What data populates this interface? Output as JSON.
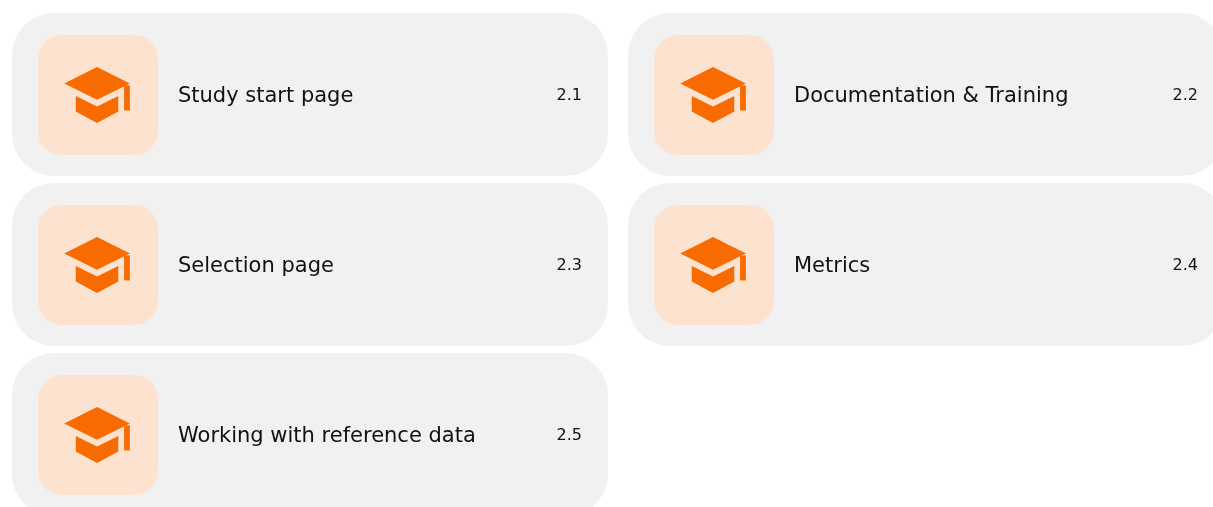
{
  "lessons": [
    {
      "title": "Study start page",
      "number": "2.1"
    },
    {
      "title": "Documentation & Training",
      "number": "2.2"
    },
    {
      "title": "Selection page",
      "number": "2.3"
    },
    {
      "title": "Metrics",
      "number": "2.4"
    },
    {
      "title": "Working with reference data",
      "number": "2.5"
    }
  ]
}
